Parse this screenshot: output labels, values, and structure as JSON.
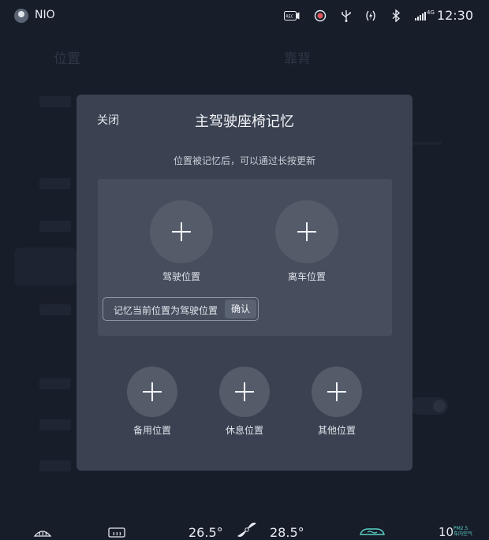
{
  "status_bar": {
    "brand": "NIO",
    "time": "12:30",
    "signal_label": "4G",
    "icons": [
      "avatar-icon",
      "camera-rec-icon",
      "face-icon",
      "usb-icon",
      "wireless-charge-icon",
      "bluetooth-icon",
      "cellular-signal-icon"
    ],
    "rec_label": "REC"
  },
  "background": {
    "left_header": "位置",
    "right_header": "靠背"
  },
  "modal": {
    "close_label": "关闭",
    "title": "主驾驶座椅记忆",
    "subtitle": "位置被记忆后，可以通过长按更新",
    "primary_slots": [
      {
        "label": "驾驶位置",
        "icon": "plus-icon"
      },
      {
        "label": "离车位置",
        "icon": "plus-icon"
      }
    ],
    "memory_prompt": "记忆当前位置为驾驶位置",
    "confirm_label": "确认",
    "secondary_slots": [
      {
        "label": "备用位置",
        "icon": "plus-icon"
      },
      {
        "label": "休息位置",
        "icon": "plus-icon"
      },
      {
        "label": "其他位置",
        "icon": "plus-icon"
      }
    ]
  },
  "climate": {
    "left_temp": "26.5°",
    "right_temp": "28.5°",
    "pm_value": "10",
    "pm_label_line1": "PM2.5",
    "pm_label_line2": "车内空气"
  },
  "colors": {
    "background": "#171d29",
    "modal": "#3a4150",
    "panel": "#464d5c",
    "accent_teal": "#5ad1c6"
  }
}
